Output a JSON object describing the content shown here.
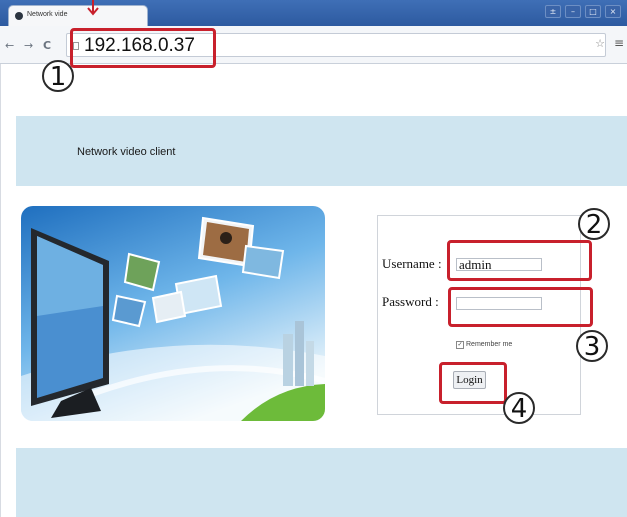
{
  "browser": {
    "tab_title": "Network vide",
    "window_controls": [
      "±",
      "–",
      "□",
      "×"
    ],
    "nav": {
      "back": "←",
      "forward": "→",
      "reload": "C"
    },
    "url": "192.168.0.37",
    "bookmark_icon": "star-icon",
    "menu_icon": "menu-icon"
  },
  "page": {
    "title": "Network video client",
    "login": {
      "username_label": "Username :",
      "username_value": "admin",
      "password_label": "Password :",
      "password_value": "",
      "remember_label": "Remember me",
      "remember_checked": true,
      "login_button": "Login"
    }
  },
  "annotations": {
    "step1": "1",
    "step2": "2",
    "step3": "3",
    "step4": "4",
    "color": "#c8202c"
  },
  "colors": {
    "band": "#cfe5f0",
    "titlebar": "#2d5aa0"
  }
}
